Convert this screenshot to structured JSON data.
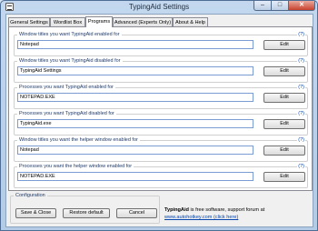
{
  "window": {
    "title": "TypingAid Settings",
    "minimize": "–",
    "maximize": "□",
    "close": "✕",
    "app_icon": "keyboard-icon"
  },
  "tabs": [
    {
      "label": "General Settings"
    },
    {
      "label": "Wordlist Box"
    },
    {
      "label": "Programs"
    },
    {
      "label": "Advanced (Experts Only)"
    },
    {
      "label": "About & Help"
    }
  ],
  "groups": [
    {
      "label": "Window titles you want TypingAid enabled for",
      "help": "(?)",
      "value": "Notepad",
      "button": "Edit"
    },
    {
      "label": "Window titles you want TypingAid disabled for",
      "help": "(?)",
      "value": "TypingAid Settings",
      "button": "Edit"
    },
    {
      "label": "Processes you want TypingAid enabled for",
      "help": "(?)",
      "value": "NOTEPAD.EXE",
      "button": "Edit"
    },
    {
      "label": "Processes you want TypingAid disabled for",
      "help": "(?)",
      "value": "TypingAid.exe",
      "button": "Edit"
    },
    {
      "label": "Window titles you want the helper window enabled for",
      "help": "(?)",
      "value": "Notepad",
      "button": "Edit"
    },
    {
      "label": "Processes you want the helper window enabled for",
      "help": "(?)",
      "value": "NOTEPAD.EXE",
      "button": "Edit"
    }
  ],
  "config": {
    "label": "Configuration",
    "save_close": "Save & Close",
    "restore_default": "Restore default",
    "cancel": "Cancel"
  },
  "footer": {
    "app_name": "TypingAid",
    "text_1": " is free software, support forum at",
    "link": "www.autohotkey.com (click here)"
  }
}
